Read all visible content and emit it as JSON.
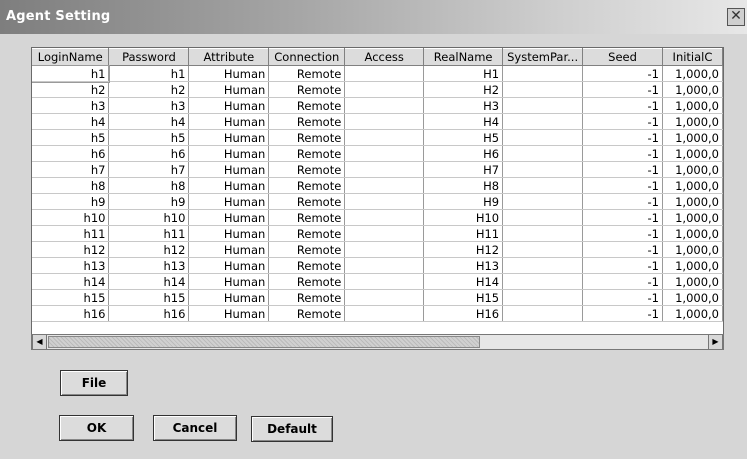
{
  "window": {
    "title": "Agent Setting",
    "close_glyph": "✕"
  },
  "table": {
    "columns": [
      "LoginName",
      "Password",
      "Attribute",
      "Connection",
      "Access",
      "RealName",
      "SystemPar...",
      "Seed",
      "InitialC"
    ],
    "rows": [
      [
        "h1",
        "h1",
        "Human",
        "Remote",
        "",
        "H1",
        "",
        "-1",
        "1,000,0"
      ],
      [
        "h2",
        "h2",
        "Human",
        "Remote",
        "",
        "H2",
        "",
        "-1",
        "1,000,0"
      ],
      [
        "h3",
        "h3",
        "Human",
        "Remote",
        "",
        "H3",
        "",
        "-1",
        "1,000,0"
      ],
      [
        "h4",
        "h4",
        "Human",
        "Remote",
        "",
        "H4",
        "",
        "-1",
        "1,000,0"
      ],
      [
        "h5",
        "h5",
        "Human",
        "Remote",
        "",
        "H5",
        "",
        "-1",
        "1,000,0"
      ],
      [
        "h6",
        "h6",
        "Human",
        "Remote",
        "",
        "H6",
        "",
        "-1",
        "1,000,0"
      ],
      [
        "h7",
        "h7",
        "Human",
        "Remote",
        "",
        "H7",
        "",
        "-1",
        "1,000,0"
      ],
      [
        "h8",
        "h8",
        "Human",
        "Remote",
        "",
        "H8",
        "",
        "-1",
        "1,000,0"
      ],
      [
        "h9",
        "h9",
        "Human",
        "Remote",
        "",
        "H9",
        "",
        "-1",
        "1,000,0"
      ],
      [
        "h10",
        "h10",
        "Human",
        "Remote",
        "",
        "H10",
        "",
        "-1",
        "1,000,0"
      ],
      [
        "h11",
        "h11",
        "Human",
        "Remote",
        "",
        "H11",
        "",
        "-1",
        "1,000,0"
      ],
      [
        "h12",
        "h12",
        "Human",
        "Remote",
        "",
        "H12",
        "",
        "-1",
        "1,000,0"
      ],
      [
        "h13",
        "h13",
        "Human",
        "Remote",
        "",
        "H13",
        "",
        "-1",
        "1,000,0"
      ],
      [
        "h14",
        "h14",
        "Human",
        "Remote",
        "",
        "H14",
        "",
        "-1",
        "1,000,0"
      ],
      [
        "h15",
        "h15",
        "Human",
        "Remote",
        "",
        "H15",
        "",
        "-1",
        "1,000,0"
      ],
      [
        "h16",
        "h16",
        "Human",
        "Remote",
        "",
        "H16",
        "",
        "-1",
        "1,000,0"
      ]
    ]
  },
  "scrollbars": {
    "up": "▲",
    "down": "▼",
    "left": "◀",
    "right": "▶"
  },
  "buttons": {
    "file": "File",
    "ok": "OK",
    "cancel": "Cancel",
    "default": "Default"
  }
}
